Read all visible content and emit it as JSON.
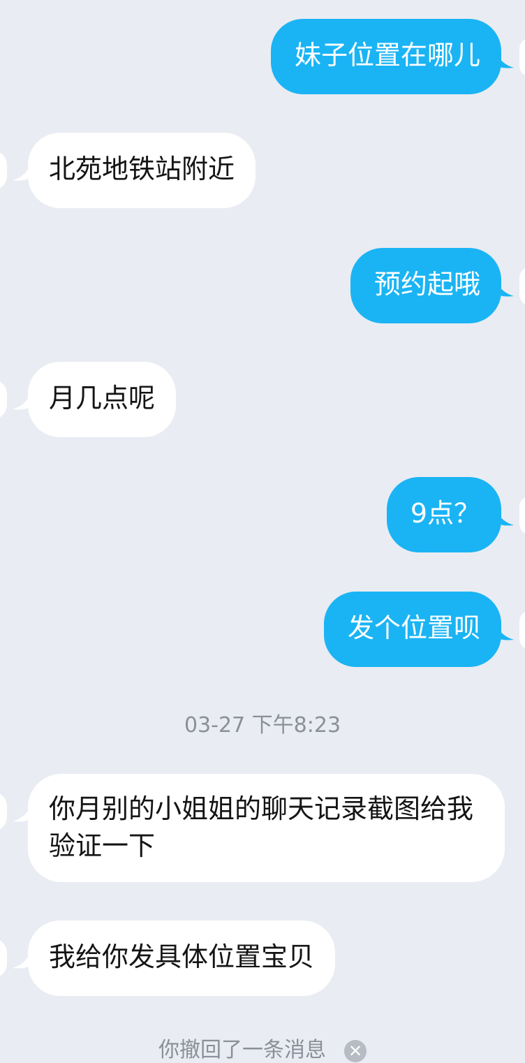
{
  "messages": [
    {
      "id": "m1",
      "direction": "out",
      "text": "妹子位置在哪儿"
    },
    {
      "id": "m2",
      "direction": "in",
      "text": "北苑地铁站附近"
    },
    {
      "id": "m3",
      "direction": "out",
      "text": "预约起哦"
    },
    {
      "id": "m4",
      "direction": "in",
      "text": "月几点呢"
    },
    {
      "id": "m5",
      "direction": "out",
      "text": "9点？"
    },
    {
      "id": "m6",
      "direction": "out",
      "text": "发个位置呗"
    },
    {
      "id": "m7",
      "direction": "in",
      "text": "你月别的小姐姐的聊天记录截图给我验证一下"
    },
    {
      "id": "m8",
      "direction": "in",
      "text": "我给你发具体位置宝贝"
    }
  ],
  "timestamp": "03-27 下午8:23",
  "recall_notice": "你撤回了一条消息",
  "colors": {
    "background": "#e9ecf2",
    "outgoing_bubble": "#1ab4f4",
    "incoming_bubble": "#ffffff",
    "timestamp_text": "#8a8f99"
  },
  "icons": {
    "recall_action": "close-circle-icon"
  }
}
